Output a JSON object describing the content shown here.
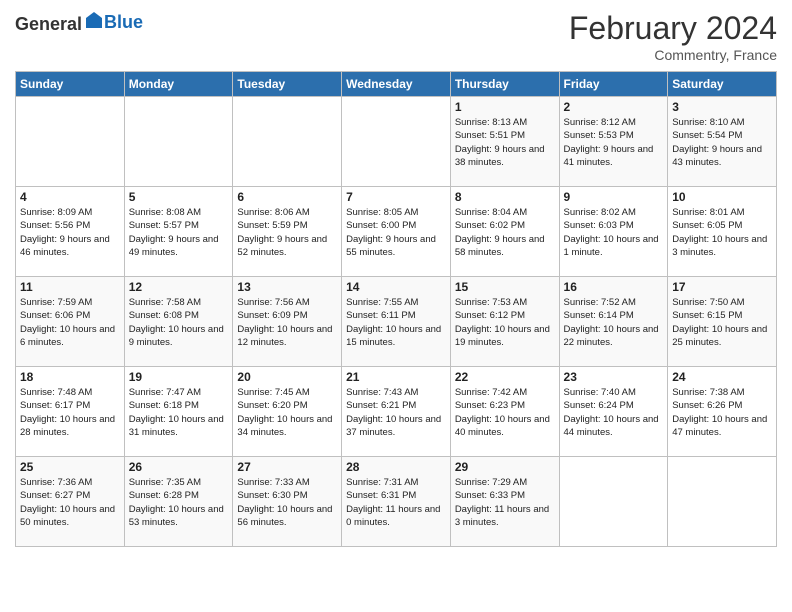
{
  "header": {
    "logo_general": "General",
    "logo_blue": "Blue",
    "title": "February 2024",
    "subtitle": "Commentry, France"
  },
  "days_of_week": [
    "Sunday",
    "Monday",
    "Tuesday",
    "Wednesday",
    "Thursday",
    "Friday",
    "Saturday"
  ],
  "weeks": [
    [
      {
        "day": "",
        "sunrise": "",
        "sunset": "",
        "daylight": ""
      },
      {
        "day": "",
        "sunrise": "",
        "sunset": "",
        "daylight": ""
      },
      {
        "day": "",
        "sunrise": "",
        "sunset": "",
        "daylight": ""
      },
      {
        "day": "",
        "sunrise": "",
        "sunset": "",
        "daylight": ""
      },
      {
        "day": "1",
        "sunrise": "Sunrise: 8:13 AM",
        "sunset": "Sunset: 5:51 PM",
        "daylight": "Daylight: 9 hours and 38 minutes."
      },
      {
        "day": "2",
        "sunrise": "Sunrise: 8:12 AM",
        "sunset": "Sunset: 5:53 PM",
        "daylight": "Daylight: 9 hours and 41 minutes."
      },
      {
        "day": "3",
        "sunrise": "Sunrise: 8:10 AM",
        "sunset": "Sunset: 5:54 PM",
        "daylight": "Daylight: 9 hours and 43 minutes."
      }
    ],
    [
      {
        "day": "4",
        "sunrise": "Sunrise: 8:09 AM",
        "sunset": "Sunset: 5:56 PM",
        "daylight": "Daylight: 9 hours and 46 minutes."
      },
      {
        "day": "5",
        "sunrise": "Sunrise: 8:08 AM",
        "sunset": "Sunset: 5:57 PM",
        "daylight": "Daylight: 9 hours and 49 minutes."
      },
      {
        "day": "6",
        "sunrise": "Sunrise: 8:06 AM",
        "sunset": "Sunset: 5:59 PM",
        "daylight": "Daylight: 9 hours and 52 minutes."
      },
      {
        "day": "7",
        "sunrise": "Sunrise: 8:05 AM",
        "sunset": "Sunset: 6:00 PM",
        "daylight": "Daylight: 9 hours and 55 minutes."
      },
      {
        "day": "8",
        "sunrise": "Sunrise: 8:04 AM",
        "sunset": "Sunset: 6:02 PM",
        "daylight": "Daylight: 9 hours and 58 minutes."
      },
      {
        "day": "9",
        "sunrise": "Sunrise: 8:02 AM",
        "sunset": "Sunset: 6:03 PM",
        "daylight": "Daylight: 10 hours and 1 minute."
      },
      {
        "day": "10",
        "sunrise": "Sunrise: 8:01 AM",
        "sunset": "Sunset: 6:05 PM",
        "daylight": "Daylight: 10 hours and 3 minutes."
      }
    ],
    [
      {
        "day": "11",
        "sunrise": "Sunrise: 7:59 AM",
        "sunset": "Sunset: 6:06 PM",
        "daylight": "Daylight: 10 hours and 6 minutes."
      },
      {
        "day": "12",
        "sunrise": "Sunrise: 7:58 AM",
        "sunset": "Sunset: 6:08 PM",
        "daylight": "Daylight: 10 hours and 9 minutes."
      },
      {
        "day": "13",
        "sunrise": "Sunrise: 7:56 AM",
        "sunset": "Sunset: 6:09 PM",
        "daylight": "Daylight: 10 hours and 12 minutes."
      },
      {
        "day": "14",
        "sunrise": "Sunrise: 7:55 AM",
        "sunset": "Sunset: 6:11 PM",
        "daylight": "Daylight: 10 hours and 15 minutes."
      },
      {
        "day": "15",
        "sunrise": "Sunrise: 7:53 AM",
        "sunset": "Sunset: 6:12 PM",
        "daylight": "Daylight: 10 hours and 19 minutes."
      },
      {
        "day": "16",
        "sunrise": "Sunrise: 7:52 AM",
        "sunset": "Sunset: 6:14 PM",
        "daylight": "Daylight: 10 hours and 22 minutes."
      },
      {
        "day": "17",
        "sunrise": "Sunrise: 7:50 AM",
        "sunset": "Sunset: 6:15 PM",
        "daylight": "Daylight: 10 hours and 25 minutes."
      }
    ],
    [
      {
        "day": "18",
        "sunrise": "Sunrise: 7:48 AM",
        "sunset": "Sunset: 6:17 PM",
        "daylight": "Daylight: 10 hours and 28 minutes."
      },
      {
        "day": "19",
        "sunrise": "Sunrise: 7:47 AM",
        "sunset": "Sunset: 6:18 PM",
        "daylight": "Daylight: 10 hours and 31 minutes."
      },
      {
        "day": "20",
        "sunrise": "Sunrise: 7:45 AM",
        "sunset": "Sunset: 6:20 PM",
        "daylight": "Daylight: 10 hours and 34 minutes."
      },
      {
        "day": "21",
        "sunrise": "Sunrise: 7:43 AM",
        "sunset": "Sunset: 6:21 PM",
        "daylight": "Daylight: 10 hours and 37 minutes."
      },
      {
        "day": "22",
        "sunrise": "Sunrise: 7:42 AM",
        "sunset": "Sunset: 6:23 PM",
        "daylight": "Daylight: 10 hours and 40 minutes."
      },
      {
        "day": "23",
        "sunrise": "Sunrise: 7:40 AM",
        "sunset": "Sunset: 6:24 PM",
        "daylight": "Daylight: 10 hours and 44 minutes."
      },
      {
        "day": "24",
        "sunrise": "Sunrise: 7:38 AM",
        "sunset": "Sunset: 6:26 PM",
        "daylight": "Daylight: 10 hours and 47 minutes."
      }
    ],
    [
      {
        "day": "25",
        "sunrise": "Sunrise: 7:36 AM",
        "sunset": "Sunset: 6:27 PM",
        "daylight": "Daylight: 10 hours and 50 minutes."
      },
      {
        "day": "26",
        "sunrise": "Sunrise: 7:35 AM",
        "sunset": "Sunset: 6:28 PM",
        "daylight": "Daylight: 10 hours and 53 minutes."
      },
      {
        "day": "27",
        "sunrise": "Sunrise: 7:33 AM",
        "sunset": "Sunset: 6:30 PM",
        "daylight": "Daylight: 10 hours and 56 minutes."
      },
      {
        "day": "28",
        "sunrise": "Sunrise: 7:31 AM",
        "sunset": "Sunset: 6:31 PM",
        "daylight": "Daylight: 11 hours and 0 minutes."
      },
      {
        "day": "29",
        "sunrise": "Sunrise: 7:29 AM",
        "sunset": "Sunset: 6:33 PM",
        "daylight": "Daylight: 11 hours and 3 minutes."
      },
      {
        "day": "",
        "sunrise": "",
        "sunset": "",
        "daylight": ""
      },
      {
        "day": "",
        "sunrise": "",
        "sunset": "",
        "daylight": ""
      }
    ]
  ]
}
